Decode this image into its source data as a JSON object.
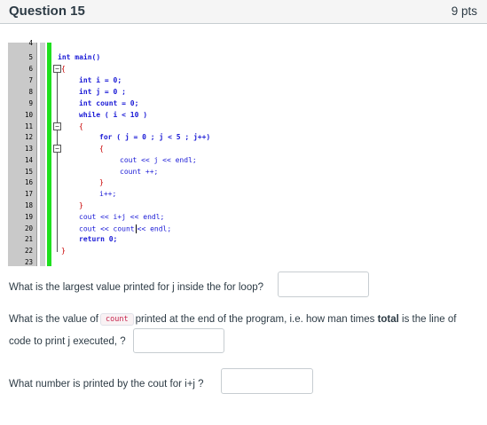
{
  "question": {
    "title": "Question 15",
    "points": "9 pts"
  },
  "code": {
    "line_numbers": [
      "4",
      "5",
      "6",
      "7",
      "8",
      "9",
      "10",
      "11",
      "12",
      "13",
      "14",
      "15",
      "16",
      "17",
      "18",
      "19",
      "20",
      "21",
      "22",
      "23"
    ],
    "lines": {
      "l5": "int main()",
      "l6": "{",
      "l7": "int i = 0;",
      "l8": "int j = 0 ;",
      "l9": "int count = 0;",
      "l10": "while ( i < 10 )",
      "l11": "{",
      "l12": "for ( j = 0 ; j < 5 ; j++)",
      "l13": "{",
      "l14": "cout << j << endl;",
      "l15": "count ++;",
      "l16": "}",
      "l17": "i++;",
      "l18": "}",
      "l19": "cout << i+j << endl;",
      "l20_a": "cout << count",
      "l20_b": "<< endl;",
      "l21": "return 0;",
      "l22": "}"
    }
  },
  "q1": {
    "text": "What is the largest value printed for j inside the for loop?",
    "answer": ""
  },
  "q2": {
    "text_a": "What is the value of",
    "code": "count",
    "text_b": "printed at the end of the program, i.e. how man times",
    "bold": "total",
    "text_c": "is the line of",
    "text_d": "code to print j executed, ?",
    "answer": ""
  },
  "q3": {
    "text": "What number is printed by the cout for i+j ?",
    "answer": ""
  }
}
